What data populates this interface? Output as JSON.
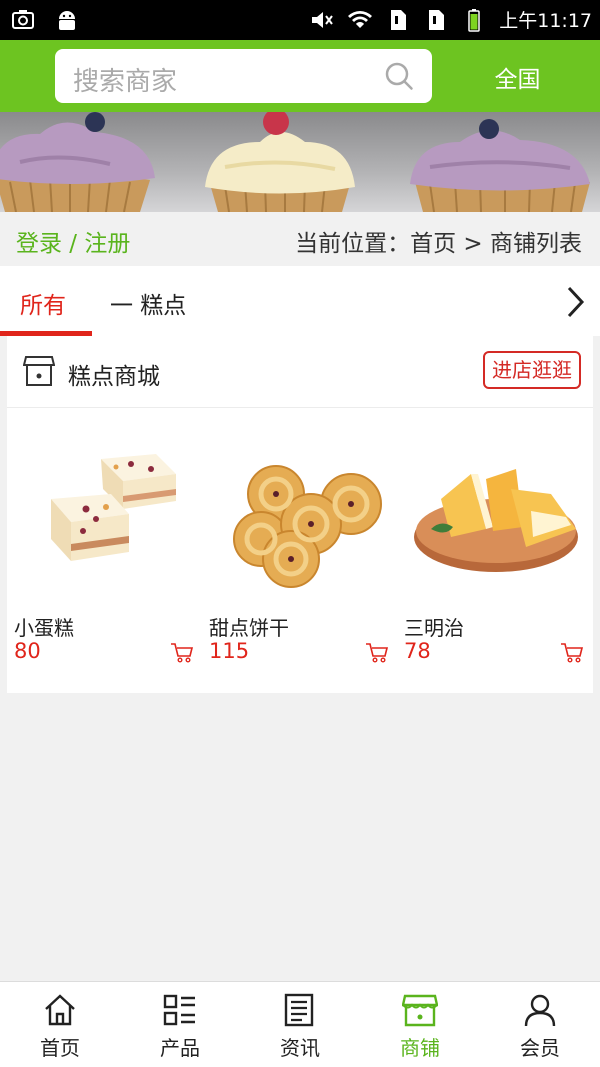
{
  "status_bar": {
    "time": "上午11:17"
  },
  "header": {
    "search_placeholder": "搜索商家",
    "region_label": "全国"
  },
  "crumbbar": {
    "login_label": "登录 / 注册",
    "breadcrumb": "当前位置：首页 > 商铺列表"
  },
  "tabs": {
    "all_label": "所有",
    "cake_label": "一 糕点"
  },
  "shop": {
    "name": "糕点商城",
    "visit_label": "进店逛逛",
    "products": [
      {
        "name": "小蛋糕",
        "price": "80"
      },
      {
        "name": "甜点饼干",
        "price": "115"
      },
      {
        "name": "三明治",
        "price": "78"
      }
    ]
  },
  "bottom_nav": {
    "items": [
      {
        "label": "首页",
        "icon": "home-icon"
      },
      {
        "label": "产品",
        "icon": "grid-list-icon"
      },
      {
        "label": "资讯",
        "icon": "news-icon"
      },
      {
        "label": "商铺",
        "icon": "store-icon"
      },
      {
        "label": "会员",
        "icon": "user-icon"
      }
    ],
    "active_index": 3
  },
  "colors": {
    "brand_green": "#6dc421",
    "accent_red": "#e0251b"
  }
}
